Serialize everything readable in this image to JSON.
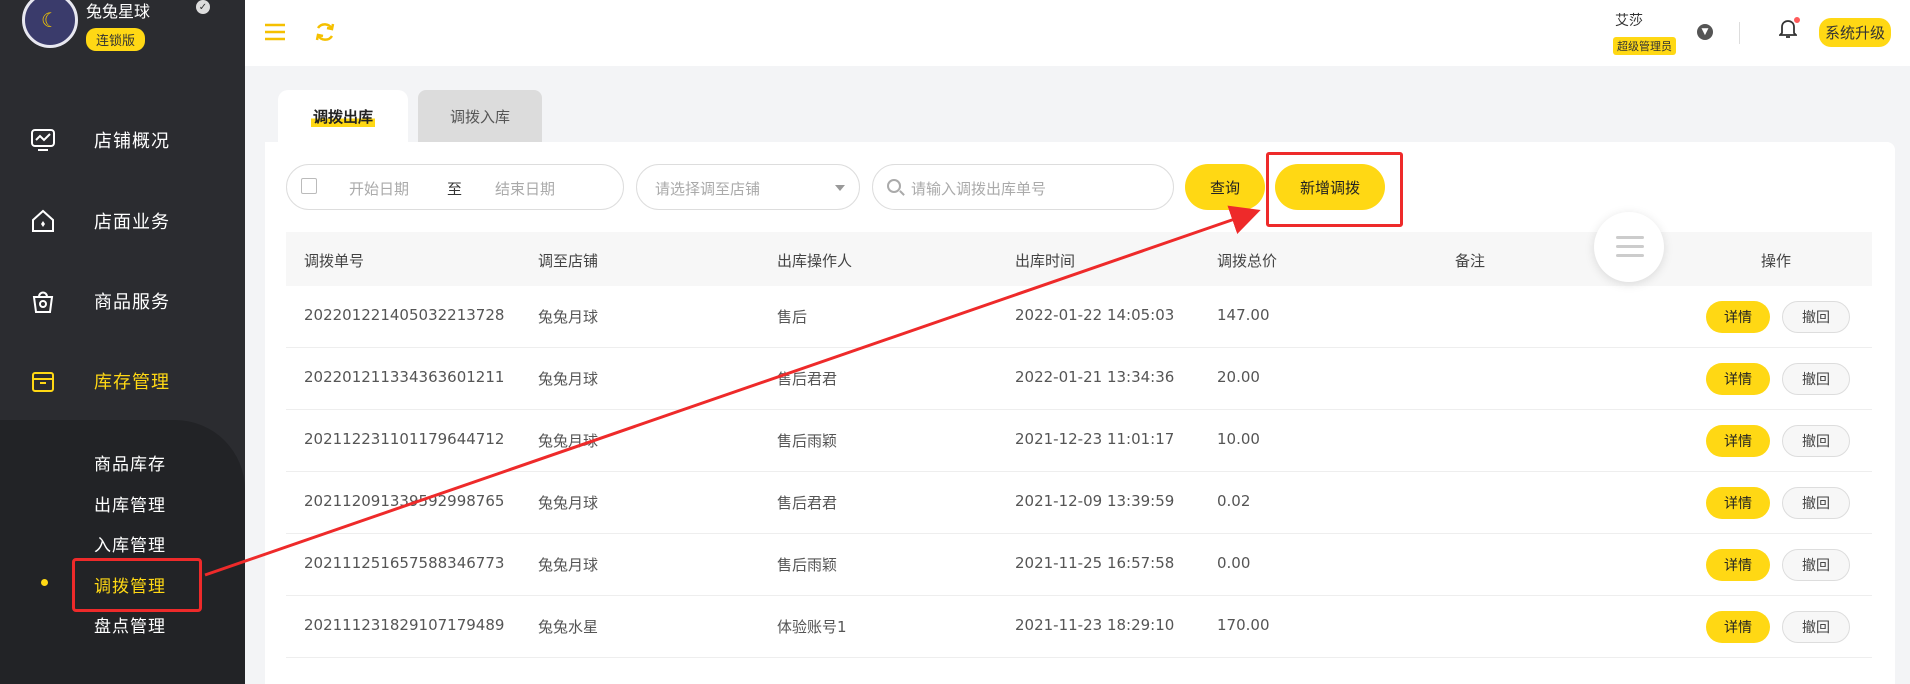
{
  "brand": {
    "name": "兔兔星球",
    "badge": "连锁版"
  },
  "nav": [
    {
      "label": "店铺概况",
      "icon": "monitor-icon"
    },
    {
      "label": "店面业务",
      "icon": "house-icon"
    },
    {
      "label": "商品服务",
      "icon": "bag-icon"
    },
    {
      "label": "库存管理",
      "icon": "box-icon"
    }
  ],
  "sub_nav": [
    "商品库存",
    "出库管理",
    "入库管理",
    "调拨管理",
    "盘点管理"
  ],
  "topbar": {
    "user_name": "艾莎",
    "user_role": "超级管理员",
    "upgrade": "系统升级"
  },
  "tabs": [
    "调拨出库",
    "调拨入库"
  ],
  "filters": {
    "start_placeholder": "开始日期",
    "to": "至",
    "end_placeholder": "结束日期",
    "store_placeholder": "请选择调至店铺",
    "search_placeholder": "请输入调拨出库单号",
    "query": "查询",
    "new": "新增调拨"
  },
  "table": {
    "headers": [
      "调拨单号",
      "调至店铺",
      "出库操作人",
      "出库时间",
      "调拨总价",
      "备注",
      "操作"
    ],
    "rows": [
      {
        "id": "20220122140503221372​8",
        "store": "兔兔月球",
        "operator": "售后",
        "time": "2022-01-22 14:05:03",
        "total": "147.00",
        "note": ""
      },
      {
        "id": "20220121133436360121​1",
        "store": "兔兔月球",
        "operator": "售后君君",
        "time": "2022-01-21 13:34:36",
        "total": "20.00",
        "note": ""
      },
      {
        "id": "20211223110117964471​2",
        "store": "兔兔月球",
        "operator": "售后雨颖",
        "time": "2021-12-23 11:01:17",
        "total": "10.00",
        "note": ""
      },
      {
        "id": "20211209133959299876​5",
        "store": "兔兔月球",
        "operator": "售后君君",
        "time": "2021-12-09 13:39:59",
        "total": "0.02",
        "note": ""
      },
      {
        "id": "20211125165758834677​3",
        "store": "兔兔月球",
        "operator": "售后雨颖",
        "time": "2021-11-25 16:57:58",
        "total": "0.00",
        "note": ""
      },
      {
        "id": "20211123182910717948​9",
        "store": "兔兔水星",
        "operator": "体验账号1",
        "time": "2021-11-23 18:29:10",
        "total": "170.00",
        "note": ""
      }
    ],
    "detail": "详情",
    "revoke": "撤回"
  }
}
